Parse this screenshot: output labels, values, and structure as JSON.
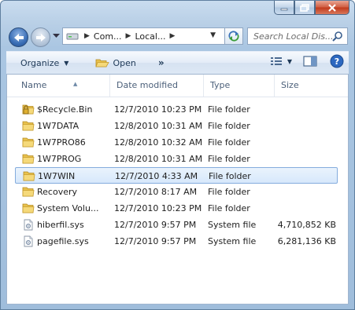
{
  "nav": {
    "address_segments": [
      "Com...",
      "Local..."
    ],
    "search_placeholder": "Search Local Dis..."
  },
  "toolbar": {
    "organize_label": "Organize",
    "open_label": "Open",
    "more_label": "»"
  },
  "columns": [
    "Name",
    "Date modified",
    "Type",
    "Size"
  ],
  "files": [
    {
      "name": "$Recycle.Bin",
      "date": "12/7/2010 10:23 PM",
      "type": "File folder",
      "size": "",
      "icon": "locked-folder-icon"
    },
    {
      "name": "1W7DATA",
      "date": "12/8/2010 10:31 AM",
      "type": "File folder",
      "size": "",
      "icon": "folder-icon"
    },
    {
      "name": "1W7PRO86",
      "date": "12/8/2010 10:32 AM",
      "type": "File folder",
      "size": "",
      "icon": "folder-icon"
    },
    {
      "name": "1W7PROG",
      "date": "12/8/2010 10:31 AM",
      "type": "File folder",
      "size": "",
      "icon": "folder-icon"
    },
    {
      "name": "1W7WIN",
      "date": "12/7/2010 4:33 AM",
      "type": "File folder",
      "size": "",
      "icon": "folder-icon",
      "selected": true
    },
    {
      "name": "Recovery",
      "date": "12/7/2010 8:17 AM",
      "type": "File folder",
      "size": "",
      "icon": "folder-icon"
    },
    {
      "name": "System Volu...",
      "date": "12/7/2010 10:23 PM",
      "type": "File folder",
      "size": "",
      "icon": "folder-icon"
    },
    {
      "name": "hiberfil.sys",
      "date": "12/7/2010 9:57 PM",
      "type": "System file",
      "size": "4,710,852 KB",
      "icon": "system-file-icon"
    },
    {
      "name": "pagefile.sys",
      "date": "12/7/2010 9:57 PM",
      "type": "System file",
      "size": "6,281,136 KB",
      "icon": "system-file-icon"
    }
  ],
  "colors": {
    "selection_border": "#84acdd",
    "selection_fill": "#d7e8fb",
    "folder_yellow": "#e8c14d",
    "close_red": "#c0391b"
  }
}
